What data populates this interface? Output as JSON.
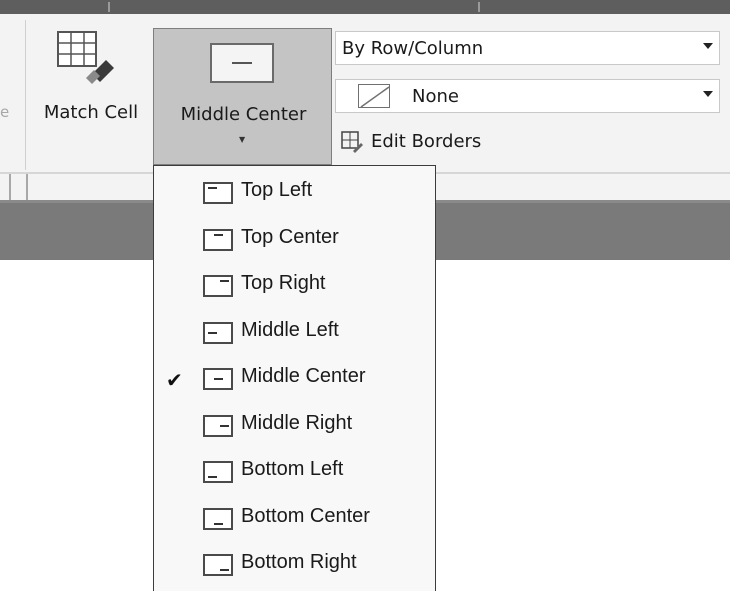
{
  "ribbon": {
    "partial_label": "e",
    "match_cell": {
      "label": "Match Cell",
      "icon": "table-paint-brush-icon"
    },
    "alignment_button": {
      "label": "Middle Center",
      "icon": "align-middle-center-icon"
    },
    "cell_style_combo": {
      "value": "By Row/Column"
    },
    "border_style_combo": {
      "value": "None",
      "icon": "no-fill-swatch-icon"
    },
    "edit_borders": {
      "label": "Edit Borders",
      "icon": "edit-borders-icon"
    }
  },
  "alignment_menu": {
    "selected": "Middle Center",
    "items": [
      {
        "label": "Top Left",
        "icon": "align-top-left-icon",
        "v": "top",
        "h": "left",
        "checked": false
      },
      {
        "label": "Top Center",
        "icon": "align-top-center-icon",
        "v": "top",
        "h": "center",
        "checked": false
      },
      {
        "label": "Top Right",
        "icon": "align-top-right-icon",
        "v": "top",
        "h": "right",
        "checked": false
      },
      {
        "label": "Middle Left",
        "icon": "align-middle-left-icon",
        "v": "middle",
        "h": "left",
        "checked": false
      },
      {
        "label": "Middle Center",
        "icon": "align-middle-center-icon",
        "v": "middle",
        "h": "center",
        "checked": true
      },
      {
        "label": "Middle Right",
        "icon": "align-middle-right-icon",
        "v": "middle",
        "h": "right",
        "checked": false
      },
      {
        "label": "Bottom Left",
        "icon": "align-bottom-left-icon",
        "v": "bottom",
        "h": "left",
        "checked": false
      },
      {
        "label": "Bottom Center",
        "icon": "align-bottom-center-icon",
        "v": "bottom",
        "h": "center",
        "checked": false
      },
      {
        "label": "Bottom Right",
        "icon": "align-bottom-right-icon",
        "v": "bottom",
        "h": "right",
        "checked": false
      }
    ]
  },
  "glyphs": {
    "check": "✔",
    "caret": "▼"
  }
}
